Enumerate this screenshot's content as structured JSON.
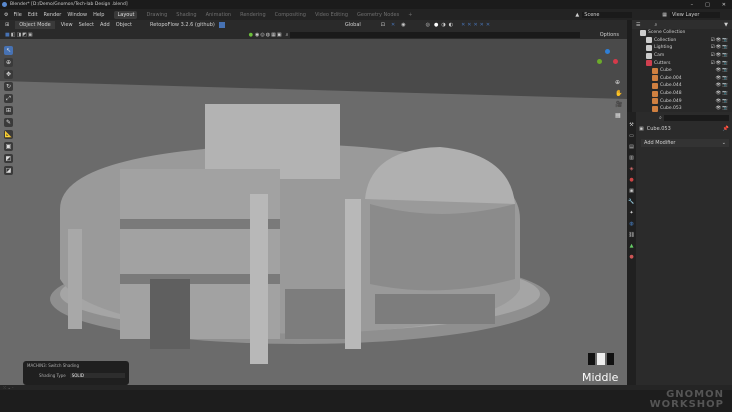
{
  "title": "Blender* [D:/Demo/Gnomon/Tech-lab Design .blend]",
  "menu": [
    "File",
    "Edit",
    "Render",
    "Window",
    "Help"
  ],
  "workspaces": [
    "Layout",
    "Drawing",
    "Shading",
    "Animation",
    "Rendering",
    "Compositing",
    "Video Editing",
    "Geometry Nodes",
    "+"
  ],
  "scene": "Scene",
  "view_layer": "View Layer",
  "header": {
    "mode": "Object Mode",
    "items": [
      "View",
      "Select",
      "Add",
      "Object"
    ],
    "addon": "RetopoFlow 3.2.6 (github)",
    "orientation": "Global",
    "options": "Options"
  },
  "outliner": {
    "root": "Scene Collection",
    "items": [
      {
        "label": "Collection",
        "indent": 1
      },
      {
        "label": "Lighting",
        "indent": 1
      },
      {
        "label": "Cam",
        "indent": 1
      },
      {
        "label": "Cutters",
        "indent": 1
      },
      {
        "label": "Cube",
        "indent": 2
      },
      {
        "label": "Cube.004",
        "indent": 2
      },
      {
        "label": "Cube.044",
        "indent": 2
      },
      {
        "label": "Cube.048",
        "indent": 2
      },
      {
        "label": "Cube.049",
        "indent": 2
      },
      {
        "label": "Cube.053",
        "indent": 2
      }
    ]
  },
  "properties": {
    "object": "Cube.053",
    "add_modifier": "Add Modifier"
  },
  "operator_panel": {
    "title": "MACHIN3: Switch Shading",
    "field_label": "Shading Type",
    "field_value": "SOLID"
  },
  "overlay_label": "Middle",
  "watermark": "GNOMON WORKSHOP",
  "colors": {
    "accent": "#4772b3",
    "bg": "#1d1d1d",
    "viewport": "#6b6b6b"
  }
}
